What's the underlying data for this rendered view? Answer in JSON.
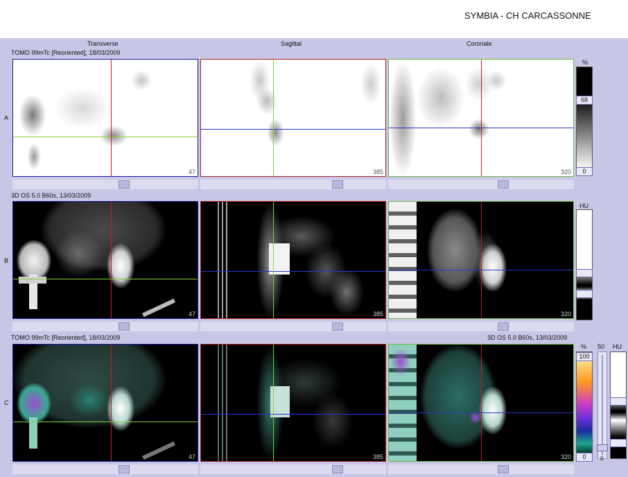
{
  "header": {
    "title": "SYMBIA - CH CARCASSONNE"
  },
  "columns": {
    "transverse": "Transverse",
    "sagittal": "Sagittal",
    "coronal": "Coronale"
  },
  "rows": {
    "a": "A",
    "b": "B",
    "c": "C"
  },
  "series": {
    "a": "TOMO 99mTc [Reoriented], 18/03/2009",
    "b": "3D  OS  5.0  B60s, 13/03/2009",
    "c_left": "TOMO 99mTc [Reoriented], 18/03/2009",
    "c_right": "3D  OS  5.0  B60s, 13/03/2009"
  },
  "slices": {
    "transverse": "47",
    "sagittal": "385",
    "coronal": "320"
  },
  "scales": {
    "a": {
      "unit": "%",
      "top": "68",
      "bottom": "0"
    },
    "b": {
      "unit": "HU"
    },
    "c": {
      "unit": "%",
      "top": "100",
      "bottom": "0",
      "blend_top": "50",
      "blend_bottom": "0",
      "ct_unit": "HU"
    }
  },
  "colors": {
    "crosshair_red": "#c0202a",
    "crosshair_green": "#7fd040",
    "crosshair_blue": "#2a36c8",
    "workspace": "#c8c6e6"
  }
}
